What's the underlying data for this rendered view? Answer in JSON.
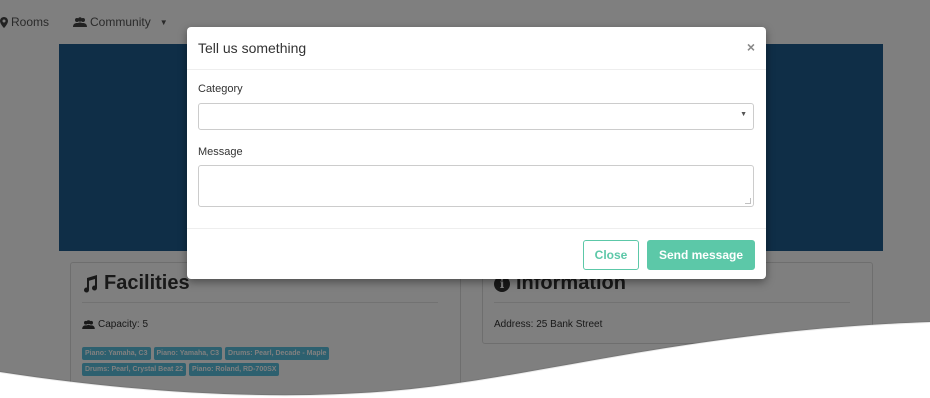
{
  "nav": {
    "rooms_label": "Rooms",
    "community_label": "Community"
  },
  "facilities": {
    "title": "Facilities",
    "capacity": "Capacity: 5",
    "tags": [
      "Piano: Yamaha, C3",
      "Piano: Yamaha, C3",
      "Drums: Pearl, Decade - Maple",
      "Drums: Pearl, Crystal Beat 22",
      "Piano: Roland, RD-700SX"
    ]
  },
  "information": {
    "title": "Information",
    "address": "Address: 25 Bank Street"
  },
  "modal": {
    "title": "Tell us something",
    "close_symbol": "×",
    "category_label": "Category",
    "category_value": "",
    "message_label": "Message",
    "message_value": "",
    "close_button": "Close",
    "send_button": "Send message"
  },
  "colors": {
    "hero": "#1f5d8f",
    "accent": "#5cc8a8",
    "tag": "#5bc0de"
  },
  "icons": {
    "rooms": "map-marker-icon",
    "community": "users-icon",
    "facilities": "music-icon",
    "capacity": "users-icon",
    "information": "info-circle-icon"
  }
}
